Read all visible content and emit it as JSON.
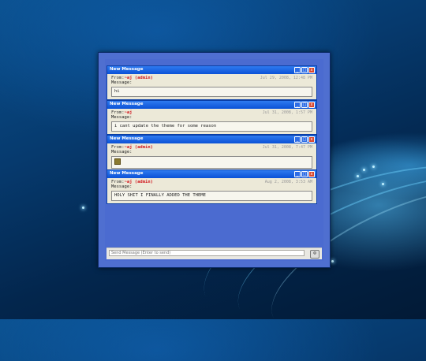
{
  "app": {
    "close_glyph": "x"
  },
  "messages": [
    {
      "title": "New Message",
      "from_label": "From:",
      "user": "~aj (admin)",
      "date": "Jul 29, 2008, 12:48 PM",
      "message_label": "Message:",
      "text": "hi"
    },
    {
      "title": "New Message",
      "from_label": "From:",
      "user": "~aj",
      "date": "Jul 31, 2008, 1:57 PM",
      "message_label": "Message:",
      "text": "i cant update the theme for some reason"
    },
    {
      "title": "New Message",
      "from_label": "From:",
      "user": "~aj (admin)",
      "date": "Jul 31, 2008, 7:47 PM",
      "message_label": "Message:",
      "text": "",
      "has_emoji": true
    },
    {
      "title": "New Message",
      "from_label": "From:",
      "user": "~aj (admin)",
      "date": "Aug 2, 2008, 3:53 AM",
      "message_label": "Message:",
      "text": "HOLY SHIT I FINALLY ADDED THE THEME"
    }
  ],
  "window_controls": {
    "minimize": "_",
    "maximize": "□",
    "close": "x"
  },
  "composer": {
    "placeholder": "Send Message (Enter to send)",
    "send_icon": "send-icon"
  },
  "colors": {
    "titlebar": "#0b52d6",
    "panel": "#4f6fd0",
    "username": "#d1171d"
  }
}
